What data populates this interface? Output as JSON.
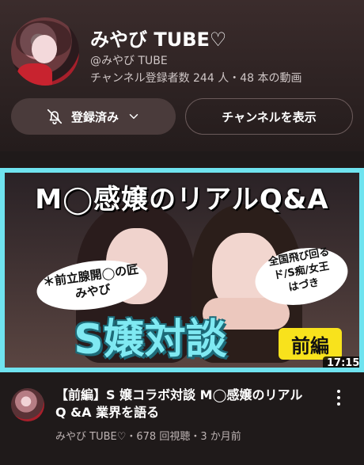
{
  "channel": {
    "name": "みやび TUBE♡",
    "handle": "@みやび TUBE",
    "stats": "チャンネル登録者数 244 人・48 本の動画"
  },
  "buttons": {
    "subscribed_label": "登録済み",
    "view_channel_label": "チャンネルを表示"
  },
  "video": {
    "thumbnail": {
      "title": "M◯感嬢のリアルQ&A",
      "bubble_left": "＊前立腺開◯の匠\nみやび",
      "bubble_right": "全国飛び回る\nド/S痴/女王\nはづき",
      "big_text": "S嬢対談",
      "badge": "前編",
      "duration": "17:15"
    },
    "title": "【前編】S 嬢コラボ対談 M◯感嬢のリアル Q &A 業界を語る",
    "meta": "みやび TUBE♡・678 回視聴・3 か月前"
  },
  "icons": {
    "bell": "bell-icon",
    "chevron": "chevron-down-icon",
    "more": "more-vert-icon"
  },
  "colors": {
    "header_bg": "#2e2323",
    "accent_cyan": "#7fe9f2",
    "badge_yellow": "#f8e21c"
  }
}
